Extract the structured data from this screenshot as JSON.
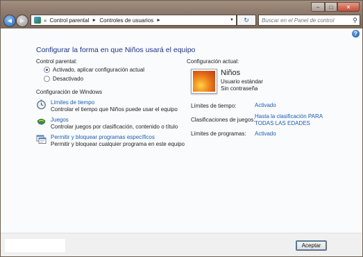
{
  "window": {
    "caption": {
      "minimize": "–",
      "maximize": "□",
      "close": "✕"
    }
  },
  "nav": {
    "back_glyph": "◄",
    "forward_glyph": "►",
    "overflow_chevron": "«",
    "breadcrumbs": [
      "Control parental",
      "Controles de usuarios"
    ],
    "crumb_separator": "►",
    "refresh_glyph": "↻",
    "search_placeholder": "Buscar en el Panel de control"
  },
  "main": {
    "title": "Configurar la forma en que Niños usará el equipo",
    "parental_label": "Control parental:",
    "options": [
      {
        "label": "Activado, aplicar configuración actual",
        "selected": true
      },
      {
        "label": "Desactivado",
        "selected": false
      }
    ],
    "windows_settings_label": "Configuración de Windows",
    "tasks": [
      {
        "icon": "clock-icon",
        "title": "Límites de tiempo",
        "description": "Controlar el tiempo que Niños puede usar el equipo"
      },
      {
        "icon": "games-icon",
        "title": "Juegos",
        "description": "Controlar juegos por clasificación, contenido o título"
      },
      {
        "icon": "programs-icon",
        "title": "Permitir y bloquear programas específicos",
        "description": "Permitir y bloquear cualquier programa en este equipo"
      }
    ]
  },
  "current": {
    "label": "Configuración actual:",
    "user": {
      "name": "Niños",
      "type": "Usuario estándar",
      "password": "Sin contraseña"
    },
    "settings": [
      {
        "label": "Límites de tiempo:",
        "value": "Activado"
      },
      {
        "label": "Clasificaciones de juegos:",
        "value": "Hasta la clasificación PARA TODAS LAS EDADES"
      },
      {
        "label": "Límites de programas:",
        "value": "Activado"
      }
    ]
  },
  "footer": {
    "ok_label": "Aceptar"
  },
  "colors": {
    "link": "#1a5db3",
    "title": "#1e3287"
  }
}
